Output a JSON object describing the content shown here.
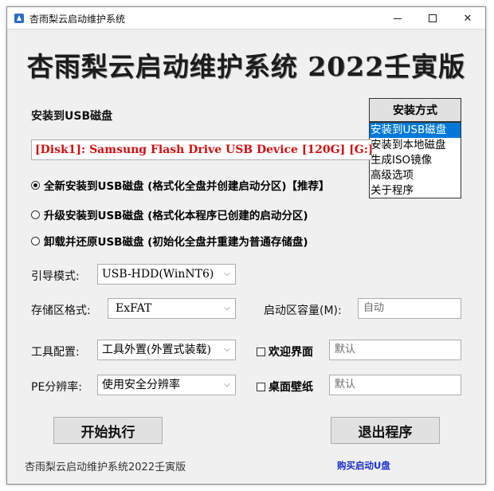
{
  "window": {
    "title": "杏雨梨云启动维护系统",
    "minimize_icon": "minimize-icon",
    "maximize_icon": "maximize-icon",
    "close_icon": "close-icon"
  },
  "banner": {
    "text": "杏雨梨云启动维护系统 2022壬寅版"
  },
  "section_title": "安装到USB磁盘",
  "install_mode": {
    "button_label": "安装方式",
    "options": [
      "安装到USB磁盘",
      "安装到本地磁盘",
      "生成ISO镜像",
      "高级选项",
      "关于程序"
    ],
    "selected_index": 0
  },
  "device": {
    "value": "[Disk1]:  Samsung Flash Drive USB Device  [120G]  [G:]"
  },
  "radios": [
    {
      "label": "全新安装到USB磁盘 (格式化全盘并创建启动分区)【推荐】",
      "checked": true
    },
    {
      "label": "升级安装到USB磁盘 (格式化本程序已创建的启动分区)",
      "checked": false
    },
    {
      "label": "卸载并还原USB磁盘 (初始化全盘并重建为普通存储盘)",
      "checked": false
    }
  ],
  "boot_mode": {
    "label": "引导模式:",
    "value": "USB-HDD(WinNT6)"
  },
  "storage_format": {
    "label": "存储区格式:",
    "value": "ExFAT"
  },
  "boot_capacity": {
    "label": "启动区容量(M):",
    "value": "自动"
  },
  "tool_config": {
    "label": "工具配置:",
    "value": "工具外置(外置式装载)"
  },
  "welcome": {
    "label": "欢迎界面",
    "checked": false,
    "value": "默认"
  },
  "pe_resolution": {
    "label": "PE分辨率:",
    "value": "使用安全分辨率"
  },
  "wallpaper": {
    "label": "桌面壁纸",
    "checked": false,
    "value": "默认"
  },
  "buttons": {
    "start": "开始执行",
    "exit": "退出程序"
  },
  "footer": {
    "text": "杏雨梨云启动维护系统2022壬寅版",
    "link": "购买启动U盘"
  },
  "colors": {
    "device_text": "#d10f0f",
    "selection": "#0078d7",
    "link": "#1a2fd0"
  }
}
